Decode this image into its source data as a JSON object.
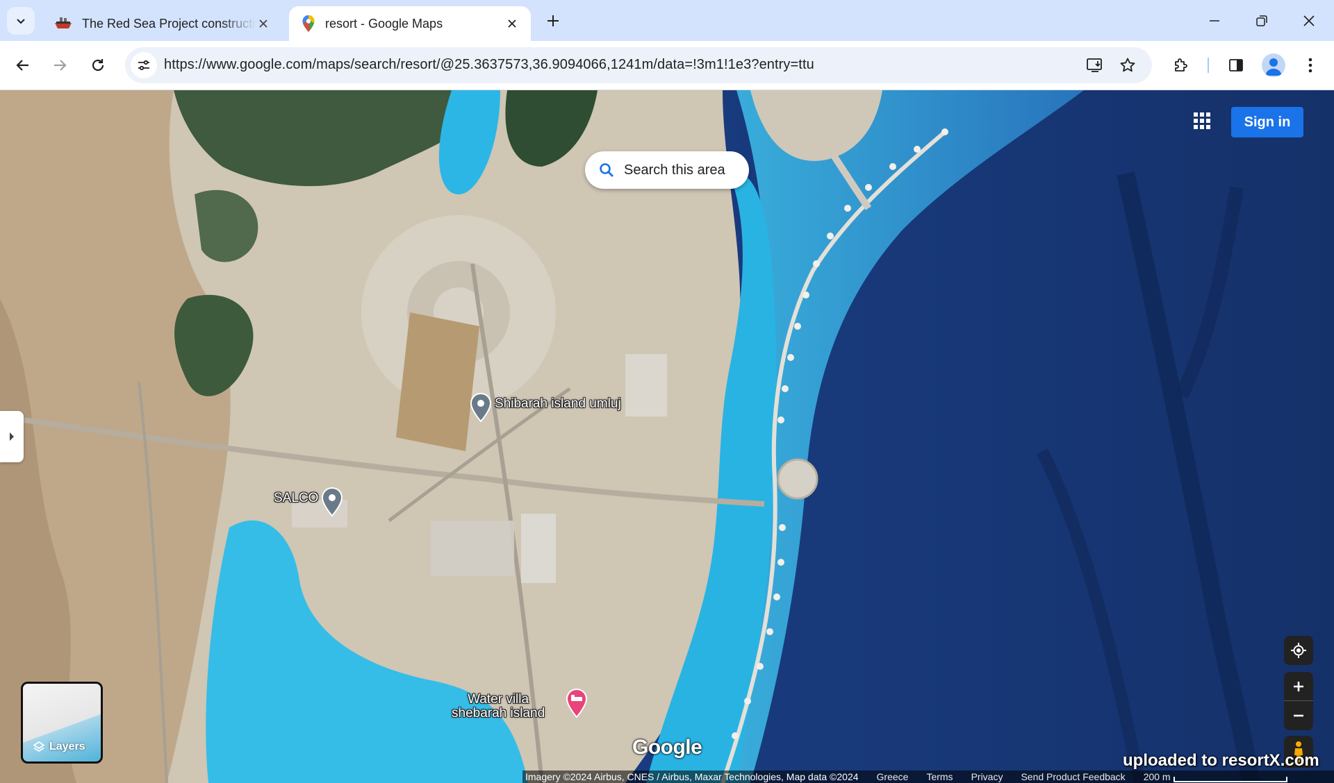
{
  "tabs": [
    {
      "title": "The Red Sea Project construction",
      "favicon": "ship-favicon-icon",
      "active": false
    },
    {
      "title": "resort - Google Maps",
      "favicon": "maps-pin-favicon-icon",
      "active": true
    }
  ],
  "omnibox": {
    "url": "https://www.google.com/maps/search/resort/@25.3637573,36.9094066,1241m/data=!3m1!1e3?entry=ttu"
  },
  "map": {
    "search_area_label": "Search this area",
    "sign_in_label": "Sign in",
    "layers_label": "Layers",
    "places": [
      {
        "name": "Shibarah island umluj",
        "type": "place-pin"
      },
      {
        "name": "SALCO",
        "type": "place-pin"
      },
      {
        "name_line1": "Water villa",
        "name_line2": "shebarah island",
        "type": "hotel-pin"
      }
    ],
    "logo": "Google",
    "watermark": "uploaded to resortX.com"
  },
  "footer": {
    "attribution": "Imagery ©2024 Airbus, CNES / Airbus, Maxar Technologies, Map data ©2024",
    "links": [
      "Greece",
      "Terms",
      "Privacy",
      "Send Product Feedback"
    ],
    "scale": "200 m"
  },
  "colors": {
    "accent": "#1a73e8",
    "tabstrip": "#d3e3fd",
    "omnibox": "#edf2fa",
    "deep_sea": "#1b3d7a",
    "lagoon": "#29b3e3",
    "sand": "#cfc6b4",
    "hotel_pin": "#e8437a"
  }
}
